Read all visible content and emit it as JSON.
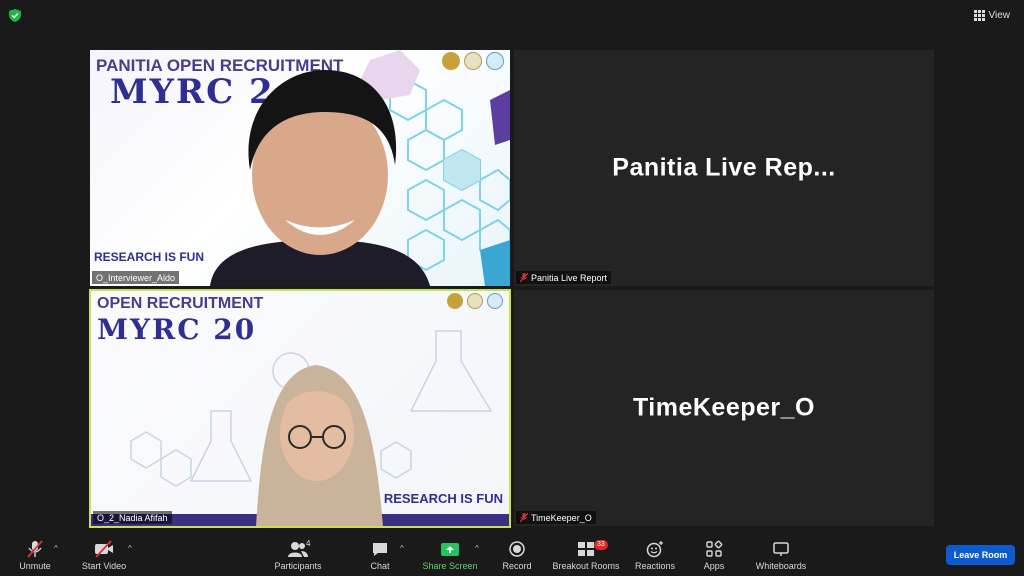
{
  "top": {
    "view_label": "View"
  },
  "tiles": {
    "t1": {
      "name": "O_Interviewer_Aldo",
      "slide_title": "PANITIA OPEN RECRUITMENT",
      "slide_big": "MYRC 2",
      "slide_footer": "RESEARCH IS FUN"
    },
    "t2": {
      "display": "Panitia Live Rep...",
      "name": "Panitia Live Report"
    },
    "t3": {
      "name": "O_2_Nadia Afifah",
      "slide_title": "OPEN RECRUITMENT",
      "slide_big": "MYRC 20",
      "slide_footer": "RESEARCH IS FUN"
    },
    "t4": {
      "display": "TimeKeeper_O",
      "name": "TimeKeeper_O"
    }
  },
  "toolbar": {
    "unmute": "Unmute",
    "start_video": "Start Video",
    "participants": "Participants",
    "participants_count": "4",
    "chat": "Chat",
    "share_screen": "Share Screen",
    "record": "Record",
    "breakout_rooms": "Breakout Rooms",
    "breakout_badge": "33",
    "reactions": "Reactions",
    "apps": "Apps",
    "whiteboards": "Whiteboards",
    "leave": "Leave Room"
  },
  "colors": {
    "active_speaker": "#c7e34a",
    "share_green": "#22c55e",
    "leave_blue": "#0e5bd0",
    "badge_red": "#e02828"
  }
}
